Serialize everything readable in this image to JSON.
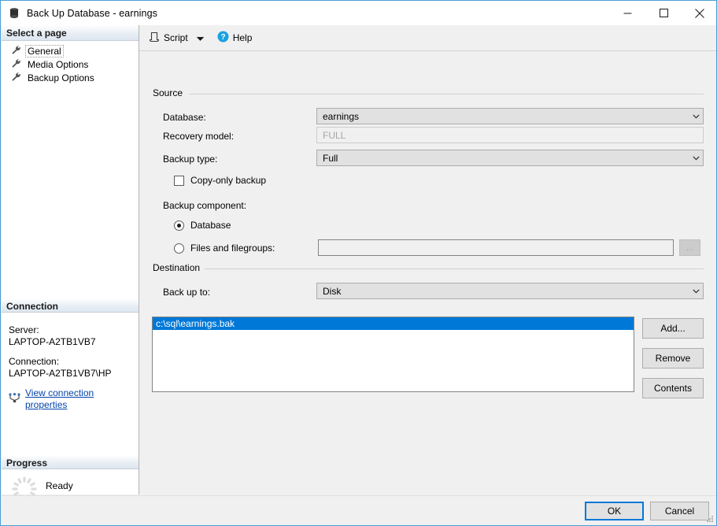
{
  "window": {
    "title": "Back Up Database - earnings",
    "icon": "database-icon",
    "minimize_label": "Minimize",
    "maximize_label": "Maximize",
    "close_label": "Close"
  },
  "sidebar": {
    "select_page_header": "Select a page",
    "pages": [
      {
        "label": "General",
        "icon": "wrench-icon",
        "selected": true
      },
      {
        "label": "Media Options",
        "icon": "wrench-icon",
        "selected": false
      },
      {
        "label": "Backup Options",
        "icon": "wrench-icon",
        "selected": false
      }
    ],
    "connection_header": "Connection",
    "server_label": "Server:",
    "server_value": "LAPTOP-A2TB1VB7",
    "connection_label": "Connection:",
    "connection_value": "LAPTOP-A2TB1VB7\\HP",
    "view_connection_properties": "View connection properties",
    "view_connection_icon": "connection-properties-icon",
    "progress_header": "Progress",
    "progress_status": "Ready",
    "progress_icon": "spinner-icon"
  },
  "toolbar": {
    "script_label": "Script",
    "script_icon": "script-icon",
    "script_caret_icon": "chevron-down-icon",
    "help_label": "Help",
    "help_icon": "help-circle-icon"
  },
  "source": {
    "legend": "Source",
    "database_label": "Database:",
    "database_value": "earnings",
    "recovery_model_label": "Recovery model:",
    "recovery_model_value": "FULL",
    "backup_type_label": "Backup type:",
    "backup_type_value": "Full",
    "copy_only_label": "Copy-only backup",
    "copy_only_checked": false,
    "backup_component_label": "Backup component:",
    "radio_database_label": "Database",
    "radio_database_checked": true,
    "radio_files_label": "Files and filegroups:",
    "radio_files_checked": false,
    "files_value": "",
    "browse_label": "..."
  },
  "destination": {
    "legend": "Destination",
    "backup_to_label": "Back up to:",
    "backup_to_value": "Disk",
    "items": [
      {
        "path": "c:\\sql\\earnings.bak",
        "selected": true
      }
    ],
    "add_label": "Add...",
    "remove_label": "Remove",
    "contents_label": "Contents"
  },
  "footer": {
    "ok_label": "OK",
    "cancel_label": "Cancel"
  },
  "colors": {
    "accent_blue": "#0078d7",
    "window_border": "#4a9ed4",
    "link_blue": "#0645ad",
    "dialog_bg": "#f0f0f0",
    "control_bg": "#e1e1e1"
  }
}
